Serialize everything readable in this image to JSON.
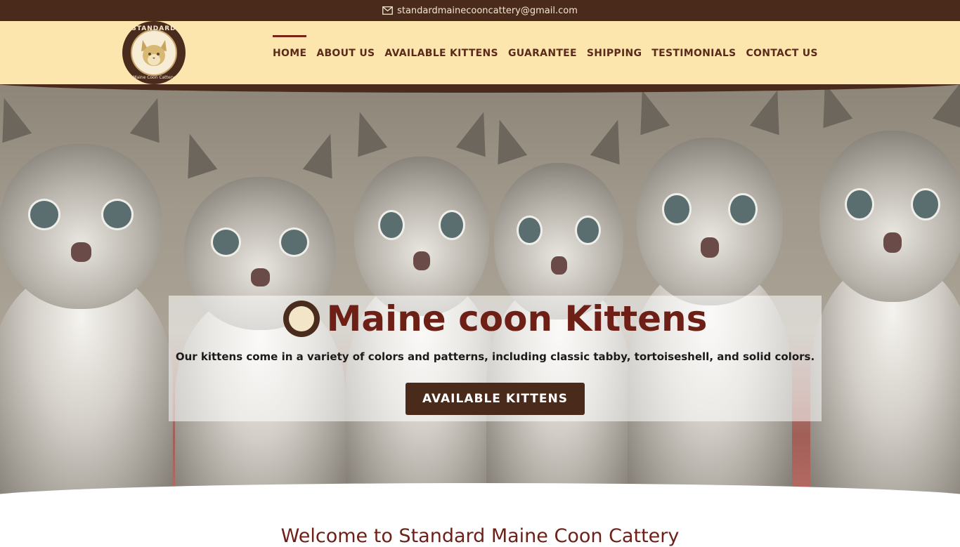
{
  "topbar": {
    "email": "standardmainecooncattery@gmail.com",
    "icon": "envelope-icon"
  },
  "brand": {
    "logo_top": "STANDARD",
    "logo_bottom": "Maine Coon Cattery"
  },
  "nav": {
    "items": [
      {
        "label": "HOME",
        "active": true
      },
      {
        "label": "ABOUT US"
      },
      {
        "label": "AVAILABLE KITTENS"
      },
      {
        "label": "GUARANTEE"
      },
      {
        "label": "SHIPPING"
      },
      {
        "label": "TESTIMONIALS"
      },
      {
        "label": "CONTACT US"
      }
    ]
  },
  "hero": {
    "title": "Maine coon Kittens",
    "description": "Our kittens come in a variety of colors and patterns, including classic tabby, tortoiseshell, and solid colors.",
    "cta_label": "AVAILABLE KITTENS"
  },
  "welcome": {
    "heading": "Welcome to Standard Maine Coon Cattery"
  },
  "colors": {
    "topbar_bg": "#4a2a1a",
    "header_bg": "#fde6ae",
    "accent": "#6e1f16",
    "button_bg": "#4a2a1a"
  }
}
